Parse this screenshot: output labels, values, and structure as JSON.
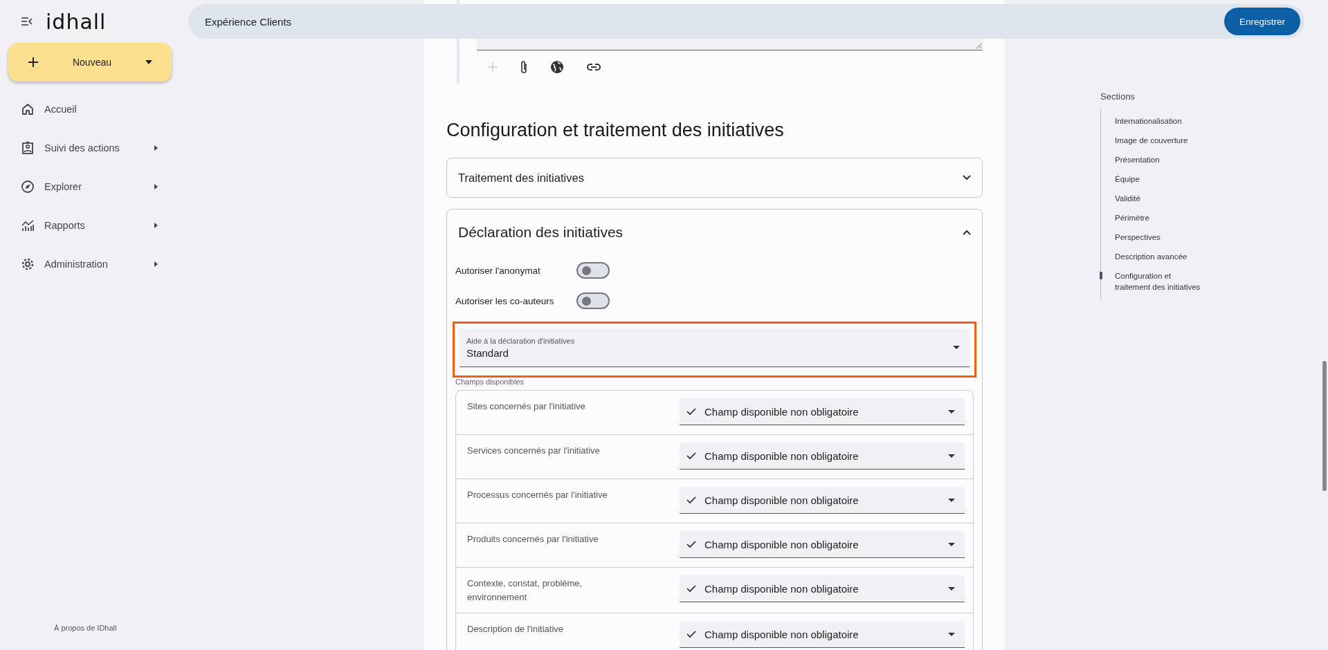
{
  "app": {
    "logo": "idhall"
  },
  "sidebar": {
    "new_button": "Nouveau",
    "items": [
      {
        "label": "Accueil",
        "has_submenu": false
      },
      {
        "label": "Suivi des actions",
        "has_submenu": true
      },
      {
        "label": "Explorer",
        "has_submenu": true
      },
      {
        "label": "Rapports",
        "has_submenu": true
      },
      {
        "label": "Administration",
        "has_submenu": true
      }
    ],
    "footer_link": "À propos de IDhall"
  },
  "header": {
    "title": "Expérience Clients",
    "save_button": "Enregistrer"
  },
  "editor_toolbar": [
    {
      "disabled": true
    },
    {
      "disabled": false
    },
    {
      "disabled": false
    },
    {
      "disabled": false
    }
  ],
  "section_title": "Configuration et traitement des initiatives",
  "accordions": [
    {
      "title": "Traitement des initiatives",
      "expanded": false
    },
    {
      "title": "Déclaration des initiatives",
      "expanded": true
    }
  ],
  "toggles": [
    {
      "label": "Autoriser l'anonymat",
      "on": false
    },
    {
      "label": "Autoriser les co-auteurs",
      "on": false
    }
  ],
  "aide_select": {
    "label": "Aide à la déclaration d'initiatives",
    "value": "Standard",
    "highlighted": true
  },
  "fields_caption": "Champs disponibles",
  "fields": [
    {
      "label": "Sites concernés par l'initiative",
      "value": "Champ disponible non obligatoire"
    },
    {
      "label": "Services concernés par l'initiative",
      "value": "Champ disponible non obligatoire"
    },
    {
      "label": "Processus concernés par l'initiative",
      "value": "Champ disponible non obligatoire"
    },
    {
      "label": "Produits concernés par l'initiative",
      "value": "Champ disponible non obligatoire"
    },
    {
      "label": "Contexte, constat, problème, environnement",
      "value": "Champ disponible non obligatoire"
    },
    {
      "label": "Description de l'initiative",
      "value": "Champ disponible non obligatoire"
    }
  ],
  "sections": {
    "title": "Sections",
    "items": [
      {
        "label": "Internationalisation",
        "selected": false
      },
      {
        "label": "Image de couverture",
        "selected": false
      },
      {
        "label": "Présentation",
        "selected": false
      },
      {
        "label": "Équipe",
        "selected": false
      },
      {
        "label": "Validité",
        "selected": false
      },
      {
        "label": "Périmètre",
        "selected": false
      },
      {
        "label": "Perspectives",
        "selected": false
      },
      {
        "label": "Description avancée",
        "selected": false
      },
      {
        "label": "Configuration et\ntraitement des initiatives",
        "selected": true
      }
    ]
  }
}
